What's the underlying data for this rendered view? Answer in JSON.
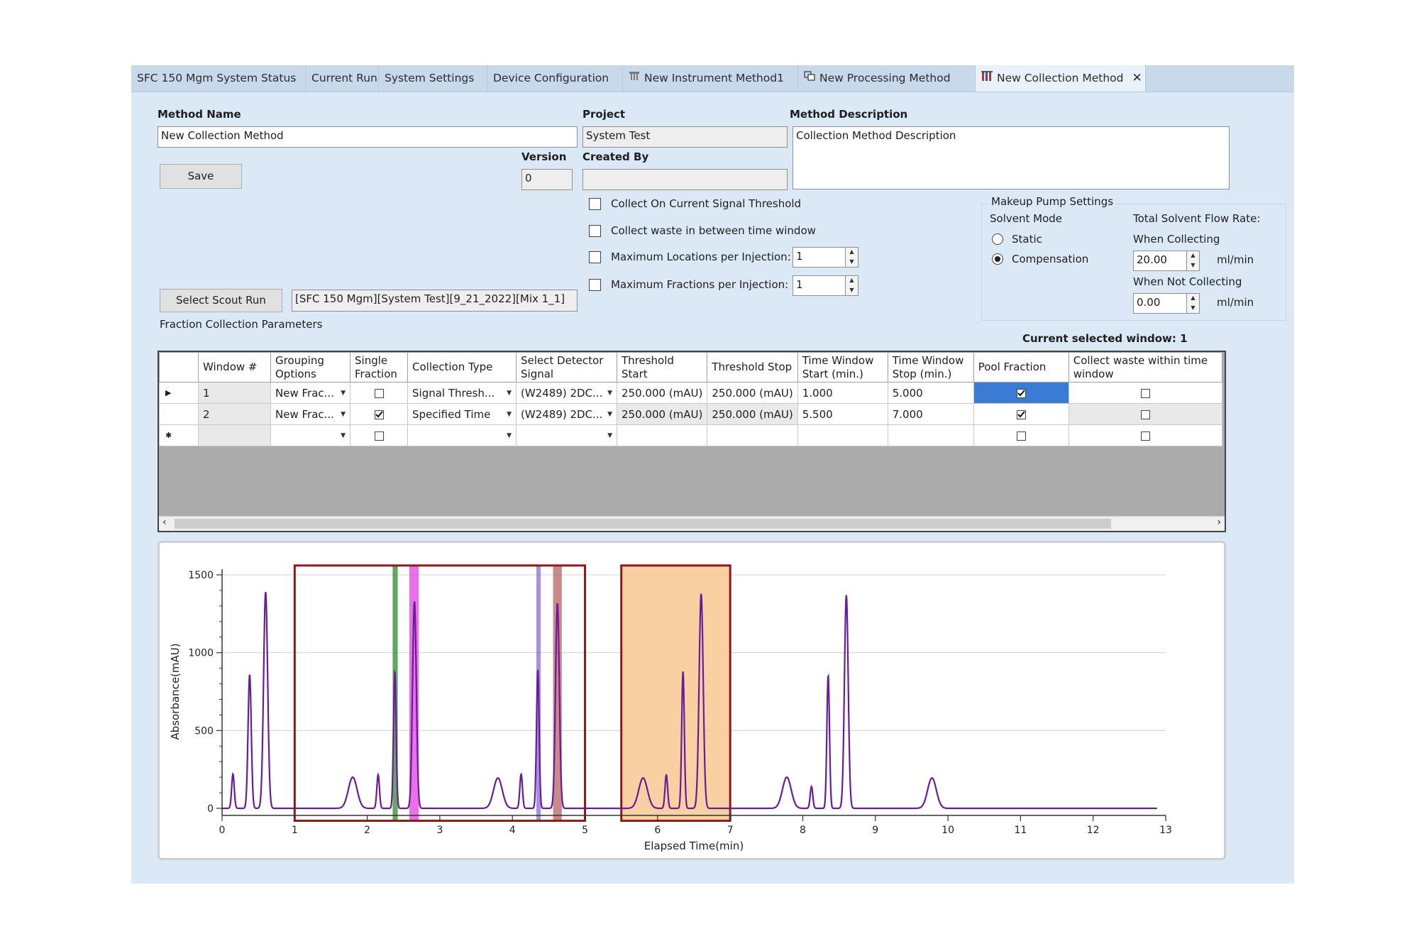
{
  "tabs": [
    {
      "label": "SFC 150 Mgm System Status",
      "icon": ""
    },
    {
      "label": "Current Run",
      "icon": ""
    },
    {
      "label": "System Settings",
      "icon": ""
    },
    {
      "label": "Device Configuration",
      "icon": ""
    },
    {
      "label": "New Instrument Method1",
      "icon": "instrument-icon"
    },
    {
      "label": "New Processing Method",
      "icon": "processing-icon"
    },
    {
      "label": "New Collection Method",
      "icon": "collection-icon",
      "active": true
    }
  ],
  "form": {
    "method_name_label": "Method Name",
    "method_name_value": "New Collection Method",
    "project_label": "Project",
    "project_value": "System Test",
    "method_description_label": "Method Description",
    "method_description_value": "Collection Method Description",
    "version_label": "Version",
    "version_value": "0",
    "created_by_label": "Created By",
    "created_by_value": "",
    "save_label": "Save",
    "select_scout_run_label": "Select Scout Run",
    "scout_run_value": "[SFC 150 Mgm][System Test][9_21_2022][Mix 1_1]"
  },
  "options": {
    "collect_on_threshold": {
      "label": "Collect On Current Signal Threshold",
      "checked": false
    },
    "collect_waste_between": {
      "label": "Collect waste in between time window",
      "checked": false
    },
    "max_locations": {
      "label": "Maximum Locations per Injection:",
      "checked": false,
      "value": "1"
    },
    "max_fractions": {
      "label": "Maximum Fractions per Injection:",
      "checked": false,
      "value": "1"
    }
  },
  "makeup_pump": {
    "title": "Makeup Pump Settings",
    "solvent_mode_label": "Solvent Mode",
    "static_label": "Static",
    "compensation_label": "Compensation",
    "selected_mode": "Compensation",
    "total_flow_label": "Total Solvent Flow Rate:",
    "when_collecting_label": "When Collecting",
    "when_collecting_value": "20.00",
    "when_not_collecting_label": "When Not Collecting",
    "when_not_collecting_value": "0.00",
    "unit": "ml/min"
  },
  "fraction_params": {
    "title": "Fraction Collection Parameters",
    "current_window_text": "Current selected window: 1",
    "columns": [
      "Window #",
      "Grouping Options",
      "Single Fraction",
      "Collection Type",
      "Select Detector Signal",
      "Threshold Start",
      "Threshold Stop",
      "Time Window Start (min.)",
      "Time Window Stop (min.)",
      "Pool Fraction",
      "Collect waste within time window"
    ],
    "rows": [
      {
        "window": "1",
        "grouping": "New Frac...",
        "single": false,
        "type": "Signal Thresh...",
        "signal": "(W2489) 2DC...",
        "th_start": "250.000 (mAU)",
        "th_stop": "250.000 (mAU)",
        "tw_start": "1.000",
        "tw_stop": "5.000",
        "pool": true,
        "waste": false,
        "current": true
      },
      {
        "window": "2",
        "grouping": "New Frac...",
        "single": true,
        "type": "Specified Time",
        "signal": "(W2489) 2DC...",
        "th_start": "250.000 (mAU)",
        "th_stop": "250.000 (mAU)",
        "tw_start": "5.500",
        "tw_stop": "7.000",
        "pool": true,
        "waste": false,
        "current": false
      }
    ]
  },
  "chart_data": {
    "type": "line",
    "xlabel": "Elapsed Time(min)",
    "ylabel": "Absorbance(mAU)",
    "xlim": [
      0,
      13
    ],
    "ylim": [
      0,
      1500
    ],
    "xticks": [
      0,
      1,
      2,
      3,
      4,
      5,
      6,
      7,
      8,
      9,
      10,
      11,
      12,
      13
    ],
    "yticks": [
      0,
      500,
      1000,
      1500
    ],
    "grid": "horizontal",
    "line_color": "#6a1b9a",
    "peaks": [
      {
        "t": 0.15,
        "h": 220,
        "w": 0.018
      },
      {
        "t": 0.38,
        "h": 860,
        "w": 0.022
      },
      {
        "t": 0.6,
        "h": 1390,
        "w": 0.028
      },
      {
        "t": 1.8,
        "h": 200,
        "w": 0.06
      },
      {
        "t": 2.15,
        "h": 215,
        "w": 0.018
      },
      {
        "t": 2.38,
        "h": 880,
        "w": 0.018
      },
      {
        "t": 2.65,
        "h": 1330,
        "w": 0.026
      },
      {
        "t": 3.8,
        "h": 195,
        "w": 0.06
      },
      {
        "t": 4.12,
        "h": 220,
        "w": 0.018
      },
      {
        "t": 4.35,
        "h": 890,
        "w": 0.018
      },
      {
        "t": 4.62,
        "h": 1320,
        "w": 0.026
      },
      {
        "t": 5.8,
        "h": 195,
        "w": 0.06
      },
      {
        "t": 6.12,
        "h": 215,
        "w": 0.018
      },
      {
        "t": 6.35,
        "h": 880,
        "w": 0.018
      },
      {
        "t": 6.6,
        "h": 1380,
        "w": 0.028
      },
      {
        "t": 7.78,
        "h": 200,
        "w": 0.06
      },
      {
        "t": 8.12,
        "h": 140,
        "w": 0.018
      },
      {
        "t": 8.35,
        "h": 855,
        "w": 0.018
      },
      {
        "t": 8.6,
        "h": 1370,
        "w": 0.026
      },
      {
        "t": 9.78,
        "h": 195,
        "w": 0.06
      }
    ],
    "windows": [
      {
        "start": 1.0,
        "stop": 5.0,
        "style": "outline",
        "color": "#8b1a1a"
      },
      {
        "start": 5.5,
        "stop": 7.0,
        "style": "filled",
        "color": "#f8c890",
        "border": "#8b1a1a"
      }
    ],
    "markers": [
      {
        "start": 2.35,
        "stop": 2.42,
        "color": "#2e8b2e"
      },
      {
        "start": 2.58,
        "stop": 2.71,
        "color": "#e040e0"
      },
      {
        "start": 4.33,
        "stop": 4.39,
        "color": "#8a6fd1"
      },
      {
        "start": 4.56,
        "stop": 4.68,
        "color": "#b46464"
      }
    ]
  }
}
